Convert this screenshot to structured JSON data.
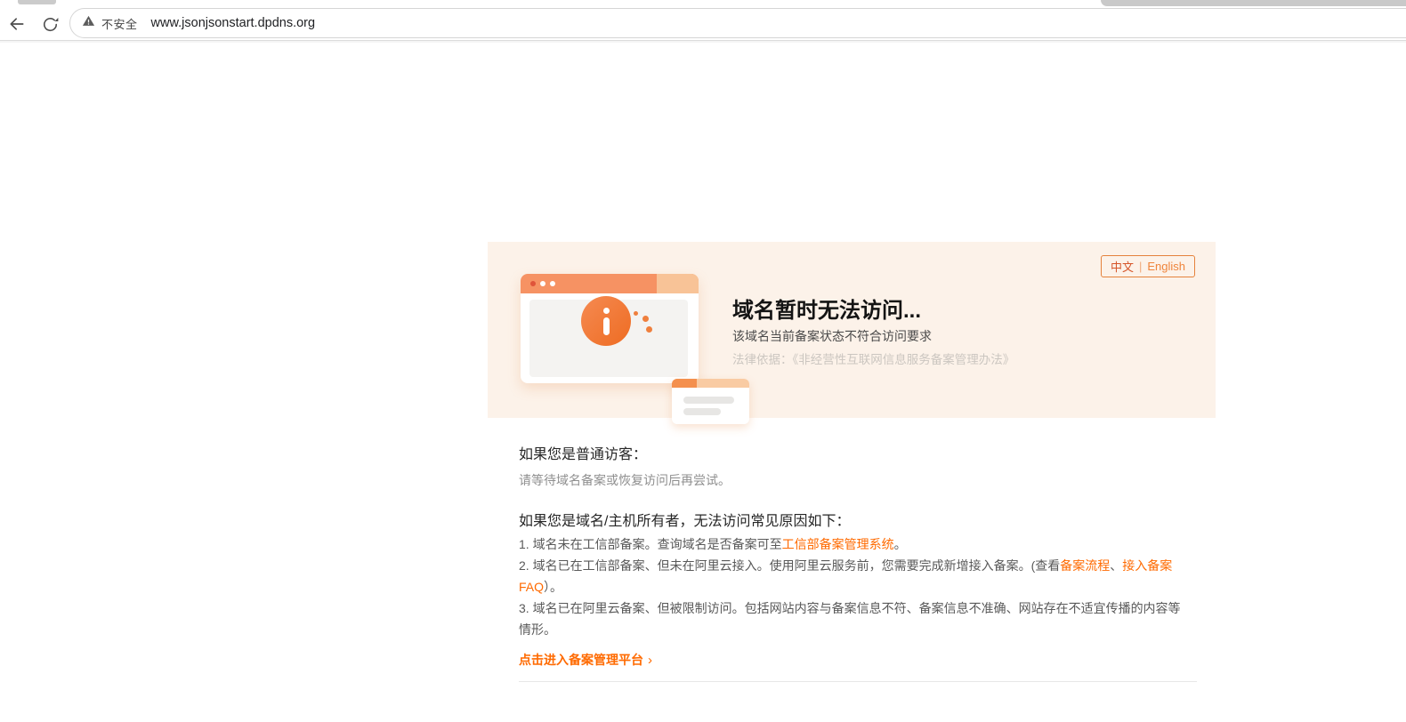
{
  "browser": {
    "security_label": "不安全",
    "url": "www.jsonjsonstart.dpdns.org",
    "back_icon": "back-arrow",
    "reload_icon": "reload-circle-arrow",
    "warning_icon": "warning-triangle"
  },
  "banner": {
    "language_switch": {
      "zh": "中文",
      "separator": "|",
      "en": "English"
    },
    "title": "域名暂时无法访问...",
    "subtitle": "该域名当前备案状态不符合访问要求",
    "legal": "法律依据：《非经营性互联网信息服务备案管理办法》",
    "illustration": "browser-window-with-info-icon"
  },
  "content": {
    "visitor_heading": "如果您是普通访客：",
    "visitor_tip": "请等待域名备案或恢复访问后再尝试。",
    "owner_heading": "如果您是域名/主机所有者，无法访问常见原因如下：",
    "reasons": {
      "item1": {
        "pre": "1. 域名未在工信部备案。查询域名是否备案可至",
        "link": "工信部备案管理系统",
        "post": "。"
      },
      "item2": {
        "pre": "2. 域名已在工信部备案、但未在阿里云接入。使用阿里云服务前，您需要完成新增接入备案。(查看",
        "link1": "备案流程",
        "mid": "、",
        "link2": "接入备案FAQ",
        "post": "）。"
      },
      "item3": {
        "text": "3. 域名已在阿里云备案、但被限制访问。包括网站内容与备案信息不符、备案信息不准确、网站存在不适宜传播的内容等情形。"
      }
    },
    "cta": {
      "label": "点击进入备案管理平台",
      "chevron": "›"
    }
  },
  "colors": {
    "accent_orange": "#ff6a00",
    "banner_background": "#fcf2e9",
    "illustration_header": "#f69263",
    "info_circle": "#ee6c22",
    "lang_button_border": "#e5823c",
    "legal_text": "#cbc6c0",
    "body_text": "#595959"
  }
}
